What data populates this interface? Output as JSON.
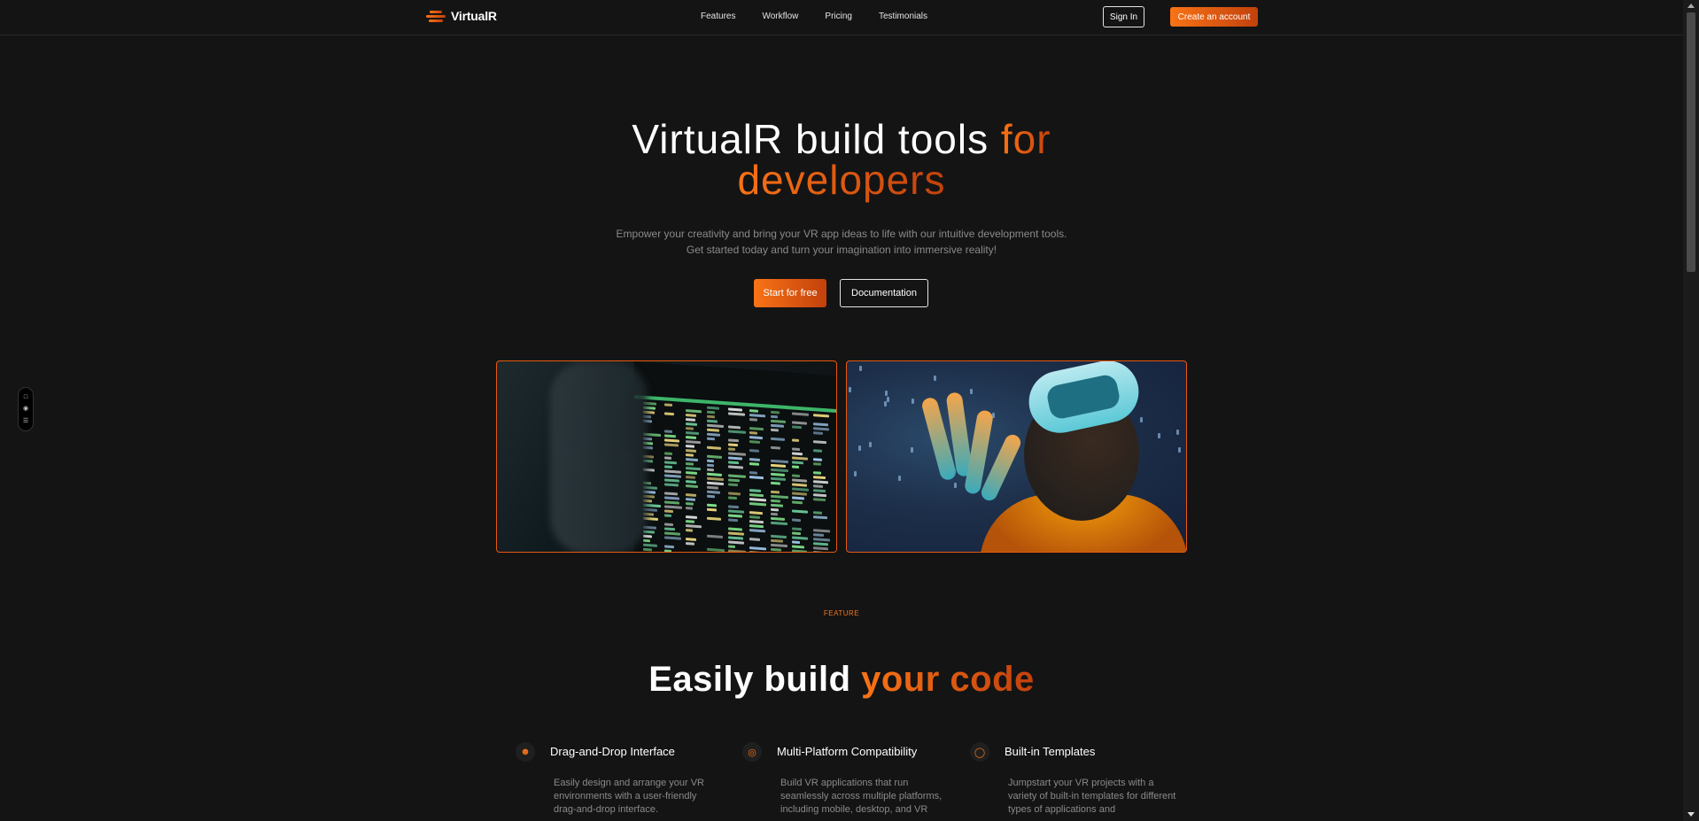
{
  "nav": {
    "brand": "VirtualR",
    "links": [
      "Features",
      "Workflow",
      "Pricing",
      "Testimonials"
    ],
    "signin": "Sign In",
    "create": "Create an account"
  },
  "hero": {
    "title_part1": "VirtualR build tools ",
    "title_accent1": "for",
    "title_accent2": "developers",
    "subtitle_line1": "Empower your creativity and bring your VR app ideas to life with our intuitive development tools.",
    "subtitle_line2": "Get started today and turn your imagination into immersive reality!",
    "start_label": "Start for free",
    "docs_label": "Documentation"
  },
  "feature": {
    "tag": "FEATURE",
    "title_part1": "Easily build ",
    "title_accent": "your code",
    "items": [
      {
        "icon": "chat-bot-icon",
        "title": "Drag-and-Drop Interface",
        "desc": "Easily design and arrange your VR environments with a user-friendly drag-and-drop interface."
      },
      {
        "icon": "fingerprint-icon",
        "title": "Multi-Platform Compatibility",
        "desc": "Build VR applications that run seamlessly across multiple platforms, including mobile, desktop, and VR"
      },
      {
        "icon": "shield-icon",
        "title": "Built-in Templates",
        "desc": "Jumpstart your VR projects with a variety of built-in templates for different types of applications and"
      }
    ]
  },
  "colors": {
    "accent": "#f97316",
    "accent_dark": "#c2410c",
    "background": "#141414"
  }
}
